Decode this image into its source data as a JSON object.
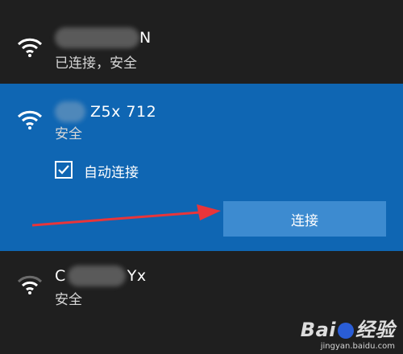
{
  "networks": [
    {
      "name_suffix": "N",
      "status": "已连接，安全",
      "signal": "wifi-full"
    },
    {
      "name_suffix": "Z5x 712",
      "status": "安全",
      "signal": "wifi-full"
    },
    {
      "name_prefix": "C",
      "name_suffix": "Yx",
      "status": "安全",
      "signal": "wifi-partial"
    }
  ],
  "selected": {
    "auto_connect_label": "自动连接",
    "auto_connect_checked": true,
    "connect_button_label": "连接"
  },
  "colors": {
    "background": "#1f1f1f",
    "selected_background": "#0f66b3",
    "button_background": "#3d8bd0",
    "arrow_color": "#e8353a"
  },
  "watermark": {
    "logo": "Bai🐾经验",
    "logo_left": "Bai",
    "logo_right": "经验",
    "url": "jingyan.baidu.com"
  }
}
